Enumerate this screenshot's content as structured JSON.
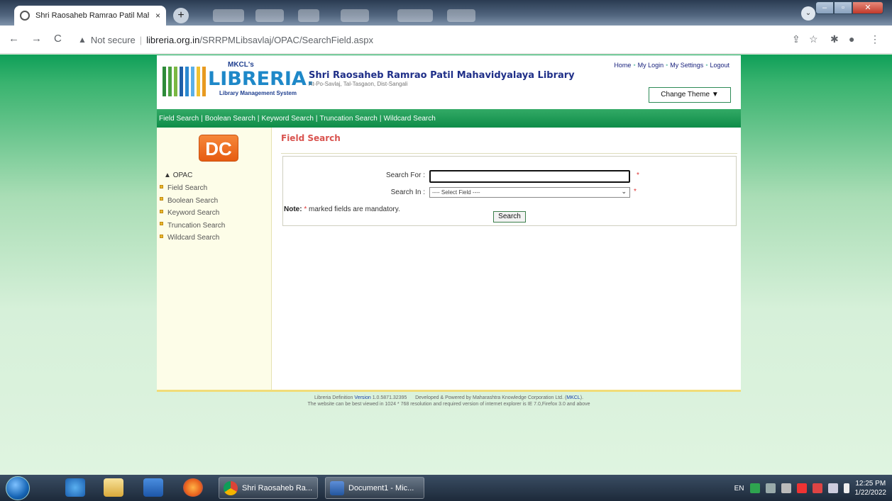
{
  "browser": {
    "tab_title": "Shri Raosaheb Ramrao Patil Mah",
    "tab_close": "×",
    "new_tab": "+",
    "security_label": "Not secure",
    "url_domain": "libreria.org.in",
    "url_path": "/SRRPMLibsavlaj/OPAC/SearchField.aspx"
  },
  "header": {
    "logo_mkcl": "MKCL's",
    "logo_libreria": "LIBRERIA.",
    "logo_subtitle": "Library Management System",
    "library_name": "Shri Raosaheb Ramrao Patil Mahavidyalaya Library",
    "library_address": "At-Po-Savlaj, Tal-Tasgaon, Dist-Sangali",
    "links": [
      "Home",
      "My Login",
      "My Settings",
      "Logout"
    ],
    "change_theme": "Change Theme"
  },
  "nav": {
    "items": [
      "Field Search",
      "Boolean Search",
      "Keyword Search",
      "Truncation Search",
      "Wildcard Search"
    ]
  },
  "sidebar": {
    "logo_text": "DC",
    "section": "OPAC",
    "items": [
      "Field Search",
      "Boolean Search",
      "Keyword Search",
      "Truncation Search",
      "Wildcard Search"
    ]
  },
  "form": {
    "title": "Field Search",
    "search_for_label": "Search For :",
    "search_for_value": "",
    "search_in_label": "Search In :",
    "search_in_selected": "---- Select Field ----",
    "required_mark": "*",
    "note_label": "Note:",
    "note_text": "marked fields are mandatory.",
    "search_button": "Search"
  },
  "footer": {
    "line1_prefix": "Libreria Definition",
    "version_label": "Version",
    "version_number": "1.0.5871.32395",
    "developed": "Developed & Powered by Maharashtra Knowledge Corporation Ltd. (",
    "mkcl": "MKCL",
    "close": ").",
    "line2": "The website can be best viewed in 1024 * 768 resolution and required version of internet explorer is IE 7.0,Firefox 3.0 and above"
  },
  "taskbar": {
    "chrome_window": "Shri Raosaheb Ra...",
    "word_window": "Document1 - Mic...",
    "language": "EN",
    "time": "12:25 PM",
    "date": "1/22/2022"
  },
  "colors": {
    "green_nav": "#0e8c48",
    "title_red": "#d9534f",
    "library_blue": "#1f2f88"
  }
}
